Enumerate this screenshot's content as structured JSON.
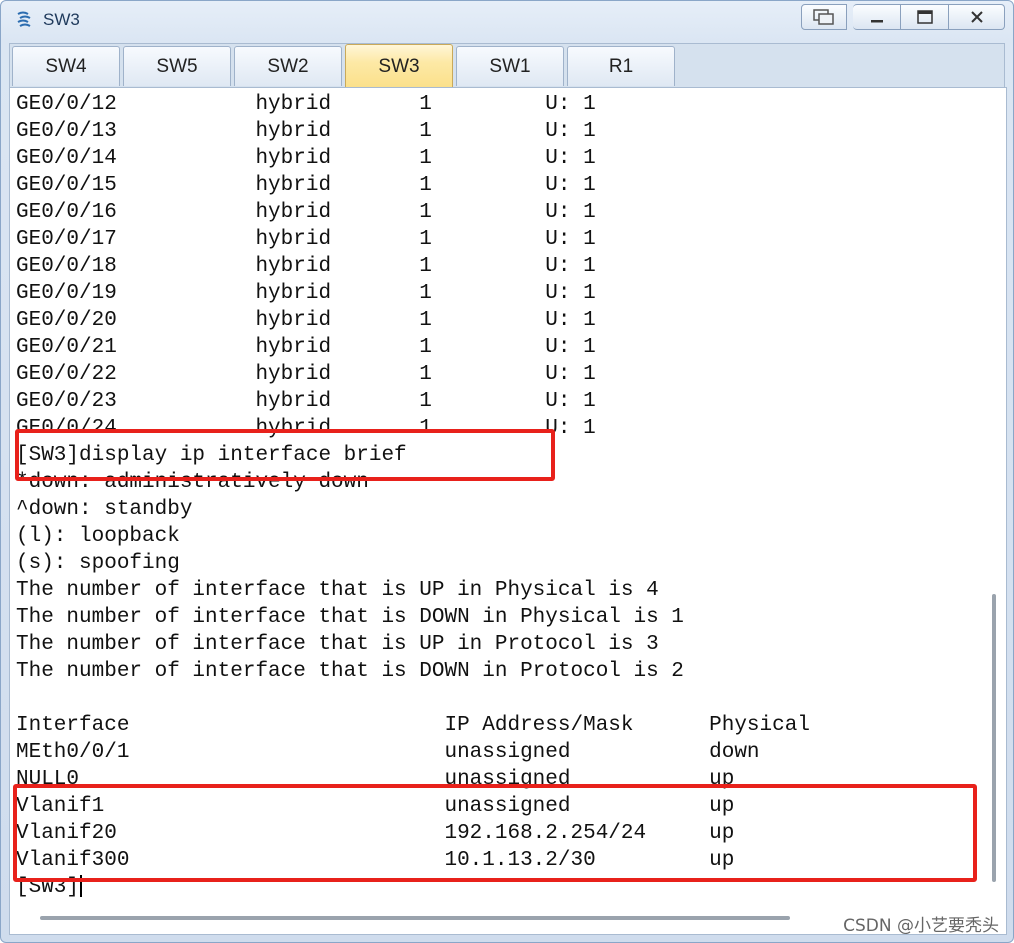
{
  "window": {
    "title": "SW3",
    "icon": "network-device-icon"
  },
  "tabs": [
    {
      "label": "SW4",
      "active": false
    },
    {
      "label": "SW5",
      "active": false
    },
    {
      "label": "SW2",
      "active": false
    },
    {
      "label": "SW3",
      "active": true
    },
    {
      "label": "SW1",
      "active": false
    },
    {
      "label": "R1",
      "active": false
    }
  ],
  "terminal": {
    "lines": [
      "GE0/0/12           hybrid       1         U: 1",
      "GE0/0/13           hybrid       1         U: 1",
      "GE0/0/14           hybrid       1         U: 1",
      "GE0/0/15           hybrid       1         U: 1",
      "GE0/0/16           hybrid       1         U: 1",
      "GE0/0/17           hybrid       1         U: 1",
      "GE0/0/18           hybrid       1         U: 1",
      "GE0/0/19           hybrid       1         U: 1",
      "GE0/0/20           hybrid       1         U: 1",
      "GE0/0/21           hybrid       1         U: 1",
      "GE0/0/22           hybrid       1         U: 1",
      "GE0/0/23           hybrid       1         U: 1",
      "GE0/0/24           hybrid       1         U: 1",
      "[SW3]display ip interface brief",
      "*down: administratively down",
      "^down: standby",
      "(l): loopback",
      "(s): spoofing",
      "The number of interface that is UP in Physical is 4",
      "The number of interface that is DOWN in Physical is 1",
      "The number of interface that is UP in Protocol is 3",
      "The number of interface that is DOWN in Protocol is 2",
      "",
      "Interface                         IP Address/Mask      Physical",
      "MEth0/0/1                         unassigned           down",
      "NULL0                             unassigned           up",
      "Vlanif1                           unassigned           up",
      "Vlanif20                          192.168.2.254/24     up",
      "Vlanif300                         10.1.13.2/30         up",
      "[SW3]"
    ]
  },
  "watermark": "CSDN @小艺要秃头",
  "colors": {
    "highlight": "#e8211b",
    "active_tab": "#fde9a6"
  }
}
